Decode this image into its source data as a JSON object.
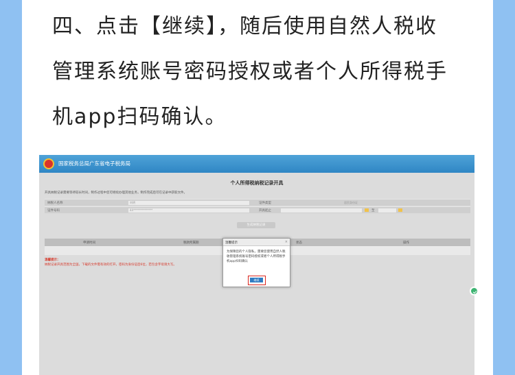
{
  "instruction": {
    "line1": "四、点击【继续】，随后使用自然人税收",
    "line2": "管理系统账号密码授权或者个人所得税手",
    "line3": "机app扫码确认。"
  },
  "screenshot": {
    "site_title": "国家税务总局广东省电子税务局",
    "page_title": "个人所得税纳税记录开具",
    "notice": "开具纳税记录需要等待较长时间，制作过程中您可继续办理其他业务，制作完成后可在记录中获取文件。",
    "form": {
      "name_label": "纳税人名称",
      "name_value": "刘明",
      "id_type_label": "证件类型",
      "id_type_value": "居民身份证",
      "id_no_label": "证件号码",
      "id_no_value": "44**************",
      "period_label": "开具起止",
      "period_sep": "至"
    },
    "generate_button": "生成纳税记录",
    "table_headers": [
      "申请时间",
      "税款所属期",
      "",
      "状态",
      "操作"
    ],
    "tips_title": "温馨提示：",
    "tips_text": "纳税记录开具范围为全国，下载的文件需有效的打开，密码为身份证后6位，若包含字母请大写。",
    "dialog": {
      "title": "温馨提示",
      "close": "×",
      "body": "为保障您的个人隐私，需要您使用自然人税收管理系统账号密码授权或者个人所得税手机app扫码确认",
      "ok": "继续"
    }
  },
  "colors": {
    "page_background": "#8fc1f2",
    "header_blue": "#2f86c4",
    "highlight_red": "#d9241c",
    "tips_red": "#d63c2e"
  },
  "icons": [
    "emblem-icon",
    "close-icon",
    "calendar-icon",
    "floating-check-icon"
  ]
}
